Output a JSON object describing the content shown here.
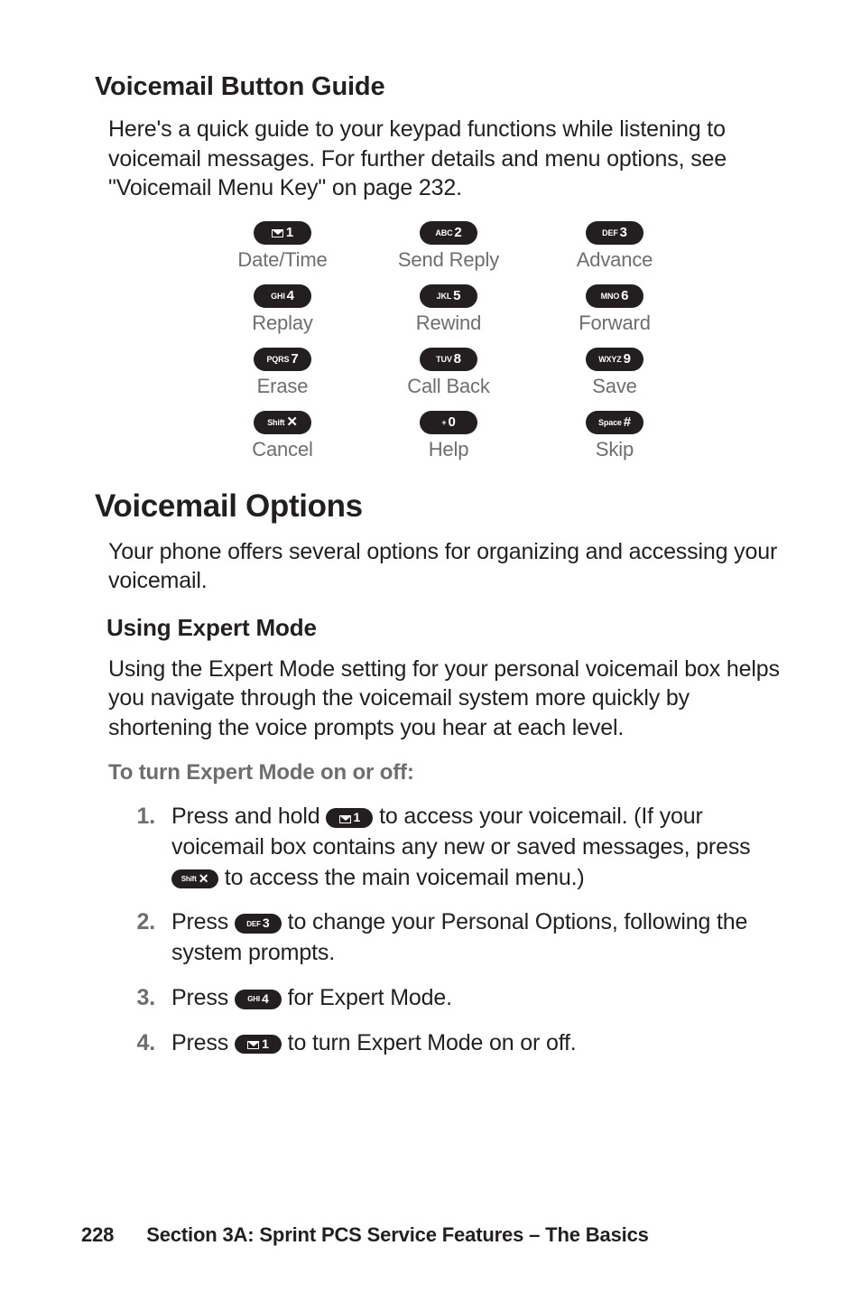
{
  "section_heading1": "Voicemail Button Guide",
  "intro1": "Here's a quick guide to your keypad functions while listening to voicemail messages. For further details and menu options, see \"Voicemail Menu Key\" on page 232.",
  "keypad": [
    {
      "keyLabelPrefix": "",
      "keyDigit": "1",
      "isEnvelope": true,
      "caption": "Date/Time"
    },
    {
      "keyLabelPrefix": "ABC",
      "keyDigit": "2",
      "isEnvelope": false,
      "caption": "Send Reply"
    },
    {
      "keyLabelPrefix": "DEF",
      "keyDigit": "3",
      "isEnvelope": false,
      "caption": "Advance"
    },
    {
      "keyLabelPrefix": "GHI",
      "keyDigit": "4",
      "isEnvelope": false,
      "caption": "Replay"
    },
    {
      "keyLabelPrefix": "JKL",
      "keyDigit": "5",
      "isEnvelope": false,
      "caption": "Rewind"
    },
    {
      "keyLabelPrefix": "MNO",
      "keyDigit": "6",
      "isEnvelope": false,
      "caption": "Forward"
    },
    {
      "keyLabelPrefix": "PQRS",
      "keyDigit": "7",
      "isEnvelope": false,
      "caption": "Erase"
    },
    {
      "keyLabelPrefix": "TUV",
      "keyDigit": "8",
      "isEnvelope": false,
      "caption": "Call Back"
    },
    {
      "keyLabelPrefix": "WXYZ",
      "keyDigit": "9",
      "isEnvelope": false,
      "caption": "Save"
    },
    {
      "keyLabelPrefix": "Shift",
      "keyDigit": "✕",
      "isEnvelope": false,
      "caption": "Cancel"
    },
    {
      "keyLabelPrefix": "+",
      "keyDigit": "0",
      "isEnvelope": false,
      "caption": "Help"
    },
    {
      "keyLabelPrefix": "Space",
      "keyDigit": "#",
      "isEnvelope": false,
      "caption": "Skip"
    }
  ],
  "major_heading": "Voicemail Options",
  "intro2": "Your phone offers several options for organizing and accessing your voicemail.",
  "section_heading2": "Using Expert Mode",
  "intro3": "Using the Expert Mode setting for your personal voicemail box helps you navigate through the voicemail system more quickly by shortening the voice prompts you hear at each level.",
  "boldline": "To turn Expert Mode on or off:",
  "steps": [
    {
      "num": "1.",
      "parts": [
        {
          "t": "text",
          "v": "Press and hold "
        },
        {
          "t": "key",
          "pref": "",
          "digit": "1",
          "env": true
        },
        {
          "t": "text",
          "v": " to access your voicemail. (If your voicemail box contains any new or saved messages, press "
        },
        {
          "t": "key",
          "pref": "Shift",
          "digit": "✕",
          "env": false
        },
        {
          "t": "text",
          "v": " to access the main voicemail menu.)"
        }
      ]
    },
    {
      "num": "2.",
      "parts": [
        {
          "t": "text",
          "v": "Press "
        },
        {
          "t": "key",
          "pref": "DEF",
          "digit": "3",
          "env": false
        },
        {
          "t": "text",
          "v": " to change your Personal Options, following the system prompts."
        }
      ]
    },
    {
      "num": "3.",
      "parts": [
        {
          "t": "text",
          "v": "Press "
        },
        {
          "t": "key",
          "pref": "GHI",
          "digit": "4",
          "env": false
        },
        {
          "t": "text",
          "v": " for Expert Mode."
        }
      ]
    },
    {
      "num": "4.",
      "parts": [
        {
          "t": "text",
          "v": "Press "
        },
        {
          "t": "key",
          "pref": "",
          "digit": "1",
          "env": true
        },
        {
          "t": "text",
          "v": " to turn Expert Mode on or off."
        }
      ]
    }
  ],
  "footer": {
    "page": "228",
    "section": "Section 3A: Sprint PCS Service Features – The Basics"
  }
}
